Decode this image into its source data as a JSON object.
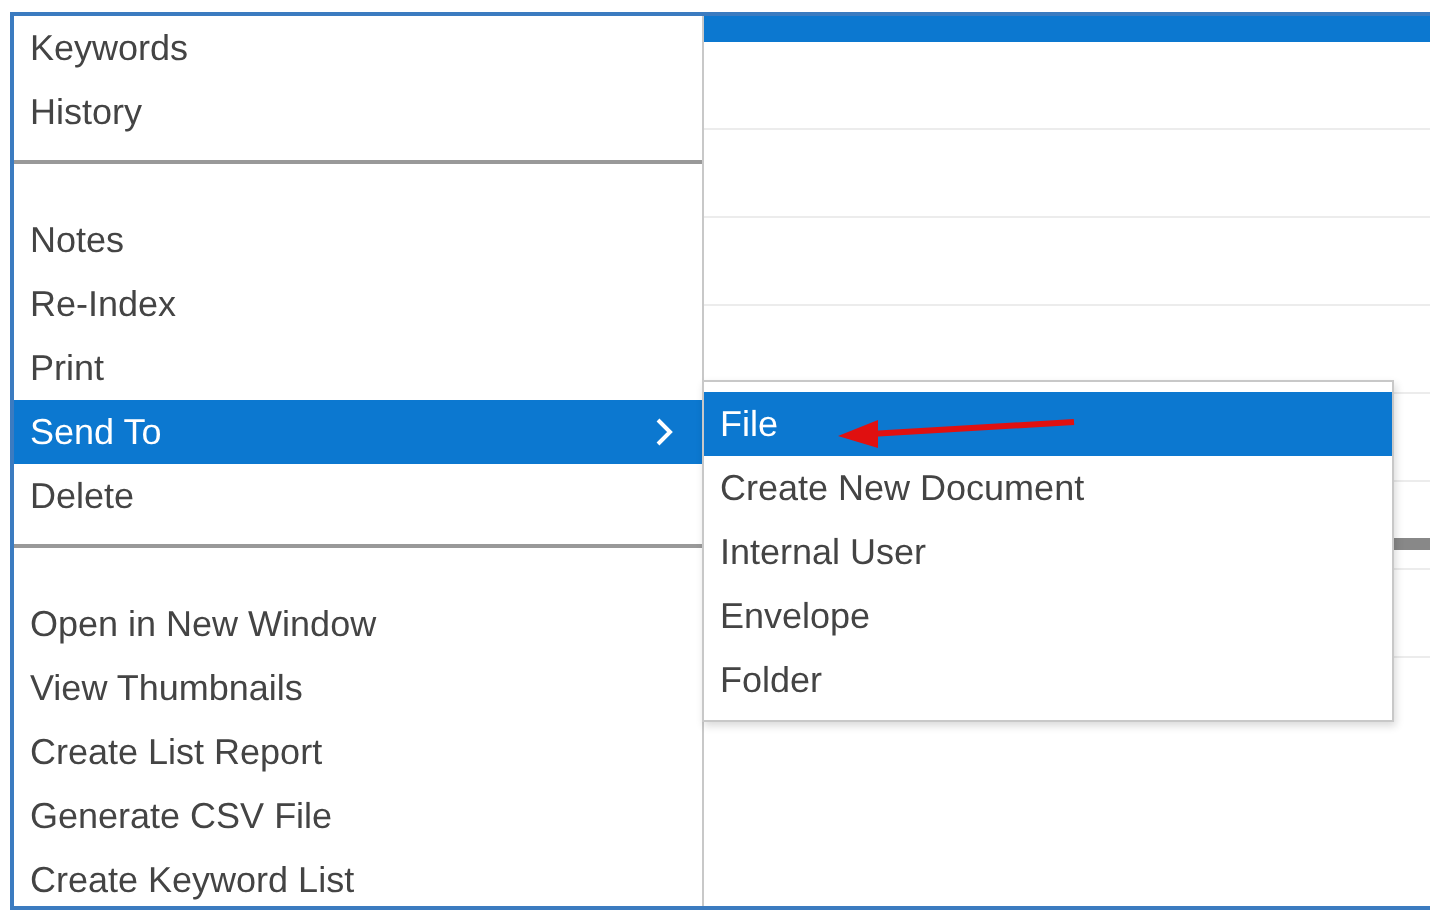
{
  "menu": {
    "groups": [
      [
        {
          "label": "Keywords",
          "selected": false,
          "has_submenu": false
        },
        {
          "label": "History",
          "selected": false,
          "has_submenu": false
        }
      ],
      [
        {
          "label": "Notes",
          "selected": false,
          "has_submenu": false
        },
        {
          "label": "Re-Index",
          "selected": false,
          "has_submenu": false
        },
        {
          "label": "Print",
          "selected": false,
          "has_submenu": false
        },
        {
          "label": "Send To",
          "selected": true,
          "has_submenu": true
        },
        {
          "label": "Delete",
          "selected": false,
          "has_submenu": false
        }
      ],
      [
        {
          "label": "Open in New Window",
          "selected": false,
          "has_submenu": false
        },
        {
          "label": "View Thumbnails",
          "selected": false,
          "has_submenu": false
        },
        {
          "label": "Create List Report",
          "selected": false,
          "has_submenu": false
        },
        {
          "label": "Generate CSV File",
          "selected": false,
          "has_submenu": false
        },
        {
          "label": "Create Keyword List",
          "selected": false,
          "has_submenu": false
        }
      ]
    ]
  },
  "submenu": {
    "items": [
      {
        "label": "File",
        "selected": true
      },
      {
        "label": "Create New Document",
        "selected": false
      },
      {
        "label": "Internal User",
        "selected": false
      },
      {
        "label": "Envelope",
        "selected": false
      },
      {
        "label": "Folder",
        "selected": false
      }
    ]
  }
}
